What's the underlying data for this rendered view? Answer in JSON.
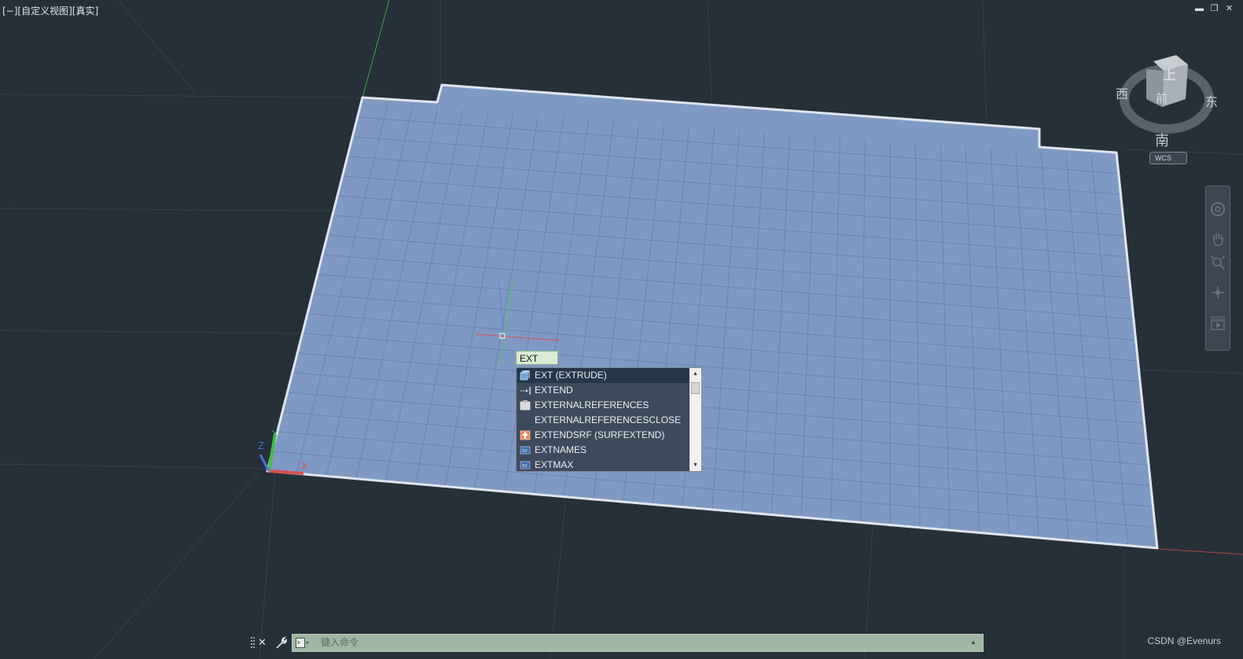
{
  "viewport": {
    "label": "[−][自定义视图][真实]"
  },
  "window_controls": {
    "minimize": "▬",
    "restore": "❐",
    "close": "✕"
  },
  "viewcube": {
    "top": "上",
    "front": "前",
    "west": "西",
    "east": "东",
    "south": "南",
    "wcs": "WCS"
  },
  "ucs": {
    "x": "X",
    "y": "Y",
    "z": "Z"
  },
  "command_input": {
    "value": "EXT"
  },
  "autocomplete": {
    "items": [
      {
        "label": "EXT (EXTRUDE)",
        "icon": "extrude-icon"
      },
      {
        "label": "EXTEND",
        "icon": "extend-icon"
      },
      {
        "label": "EXTERNALREFERENCES",
        "icon": "xref-palette-icon"
      },
      {
        "label": "EXTERNALREFERENCESCLOSE",
        "icon": ""
      },
      {
        "label": "EXTENDSRF (SURFEXTEND)",
        "icon": "surface-extend-icon"
      },
      {
        "label": "EXTNAMES",
        "icon": "system-variable-icon"
      },
      {
        "label": "EXTMAX",
        "icon": "system-variable-icon"
      }
    ],
    "selected_index": 0
  },
  "command_line": {
    "placeholder": "键入命令"
  },
  "watermark": "CSDN @Evenurs",
  "colors": {
    "background": "#263039",
    "plate_fill": "#7f99c4",
    "plate_edge": "#dfe6ee",
    "axis_x": "#d9534f",
    "axis_y": "#3fbf3f",
    "axis_z": "#4a6fd8"
  }
}
